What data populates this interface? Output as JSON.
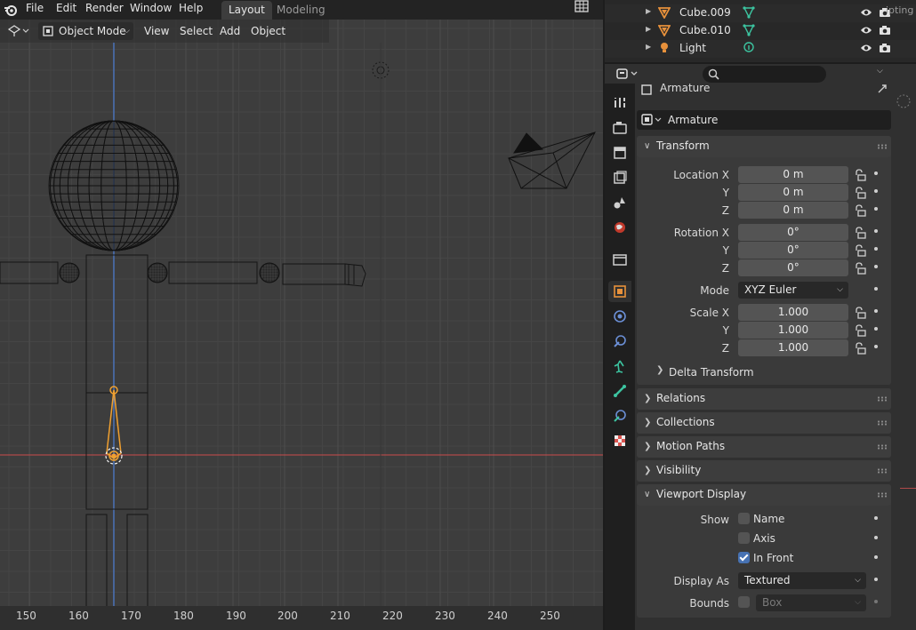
{
  "topbar": {
    "menus": [
      "File",
      "Edit",
      "Render",
      "Window",
      "Help"
    ],
    "workspace_tabs": [
      {
        "label": "Layout",
        "active": true
      },
      {
        "label": "Modeling",
        "active": false
      }
    ]
  },
  "viewport": {
    "mode": "Object Mode",
    "menus": [
      "View",
      "Select",
      "Add",
      "Object"
    ],
    "ruler_labels": [
      "150",
      "160",
      "170",
      "180",
      "190",
      "200",
      "210",
      "220",
      "230",
      "240",
      "250"
    ]
  },
  "outliner": {
    "rows": [
      {
        "name": "Cube.009",
        "icon": "mesh-icon",
        "data_icon": "vertex-data-icon"
      },
      {
        "name": "Cube.010",
        "icon": "mesh-icon",
        "data_icon": "vertex-data-icon"
      },
      {
        "name": "Light",
        "icon": "light-icon",
        "data_icon": "light-data-icon"
      }
    ],
    "scripting_tab": "ipting"
  },
  "properties": {
    "context_label": "Armature",
    "object_name": "Armature",
    "transform": {
      "title": "Transform",
      "location": {
        "label_x": "Location X",
        "x": "0 m",
        "y": "0 m",
        "z": "0 m"
      },
      "rotation": {
        "label_x": "Rotation X",
        "x": "0°",
        "y": "0°",
        "z": "0°"
      },
      "mode_label": "Mode",
      "mode_value": "XYZ Euler",
      "scale": {
        "label_x": "Scale X",
        "x": "1.000",
        "y": "1.000",
        "z": "1.000"
      },
      "axis_y": "Y",
      "axis_z": "Z",
      "delta": "Delta Transform"
    },
    "panels": {
      "relations": "Relations",
      "collections": "Collections",
      "motion_paths": "Motion Paths",
      "visibility": "Visibility",
      "viewport_display": "Viewport Display"
    },
    "viewport_display": {
      "show_label": "Show",
      "name_label": "Name",
      "name_checked": false,
      "axis_label": "Axis",
      "axis_checked": false,
      "in_front_label": "In Front",
      "in_front_checked": true,
      "display_as_label": "Display As",
      "display_as_value": "Textured",
      "bounds_label": "Bounds",
      "bounds_checked": false,
      "bounds_value": "Box"
    }
  },
  "colors": {
    "accent_blue": "#4772b3",
    "bone_orange": "#f0a030",
    "axis_red": "#c74a4a",
    "axis_blue": "#3b6fc4"
  }
}
